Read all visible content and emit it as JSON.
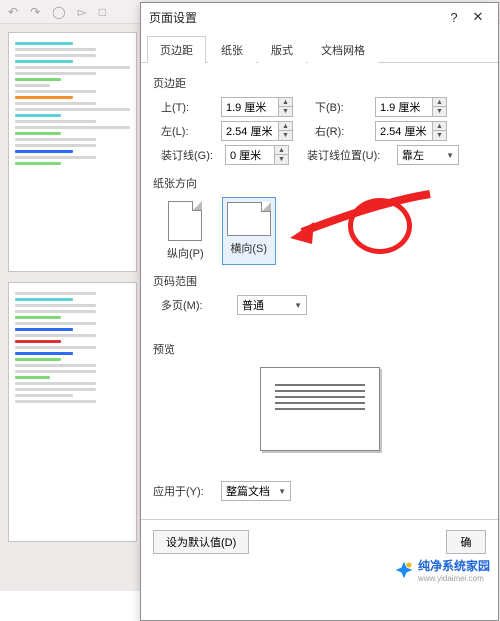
{
  "dialog": {
    "title": "页面设置",
    "tabs": [
      "页边距",
      "纸张",
      "版式",
      "文档网格"
    ],
    "margins": {
      "section_label": "页边距",
      "top_label": "上(T):",
      "top_value": "1.9 厘米",
      "bottom_label": "下(B):",
      "bottom_value": "1.9 厘米",
      "left_label": "左(L):",
      "left_value": "2.54 厘米",
      "right_label": "右(R):",
      "right_value": "2.54 厘米",
      "gutter_label": "装订线(G):",
      "gutter_value": "0 厘米",
      "gutter_pos_label": "装订线位置(U):",
      "gutter_pos_value": "靠左"
    },
    "orientation": {
      "section_label": "纸张方向",
      "portrait_label": "纵向(P)",
      "landscape_label": "横向(S)"
    },
    "pages": {
      "section_label": "页码范围",
      "multi_label": "多页(M):",
      "multi_value": "普通"
    },
    "preview": {
      "section_label": "预览"
    },
    "apply": {
      "label": "应用于(Y):",
      "value": "整篇文档"
    },
    "footer": {
      "default_btn": "设为默认值(D)",
      "ok_btn": "确"
    }
  },
  "watermark": {
    "brand": "纯净系统家园",
    "domain": "www.yidaimei.com"
  }
}
